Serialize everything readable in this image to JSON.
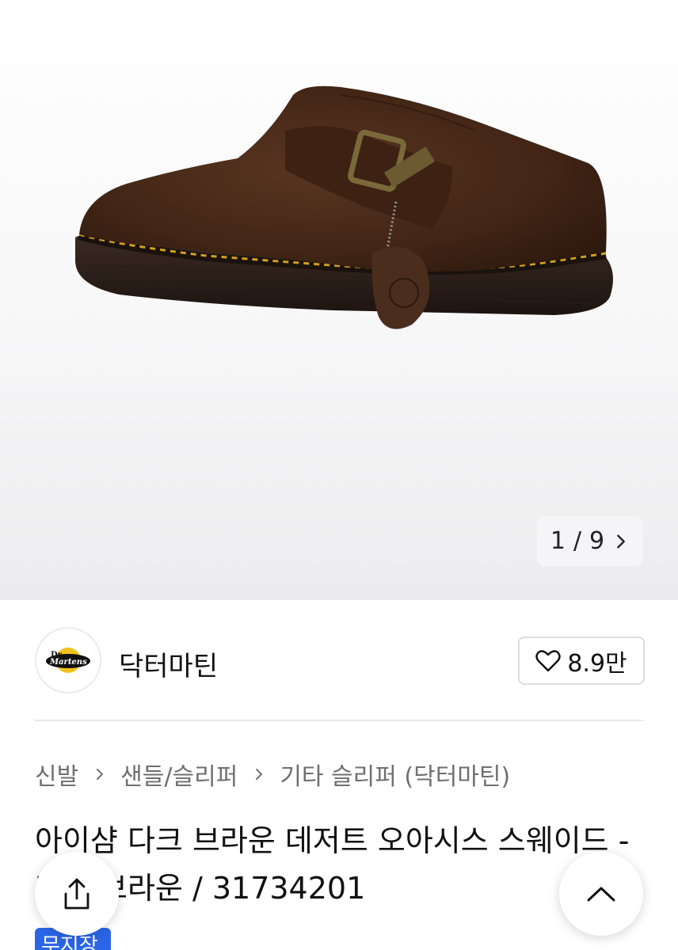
{
  "gallery": {
    "current": "1",
    "separator": "/",
    "total": "9",
    "image_alt": "Dr. Martens dark brown suede mule with buckle strap"
  },
  "brand": {
    "name": "닥터마틴",
    "logo_text": "Dr. Martens",
    "likes": "8.9만"
  },
  "breadcrumb": {
    "items": [
      "신발",
      "샌들/슬리퍼",
      "기타 슬리퍼 (닥터마틴)"
    ]
  },
  "product": {
    "title": "아이샴 다크 브라운 데저트 오아시스 스웨이드 - 다크 브라운 / 31734201",
    "badge": "무지장"
  },
  "icons": {
    "next": "chevron-right-icon",
    "heart": "heart-icon",
    "share": "share-icon",
    "top": "chevron-up-icon"
  }
}
